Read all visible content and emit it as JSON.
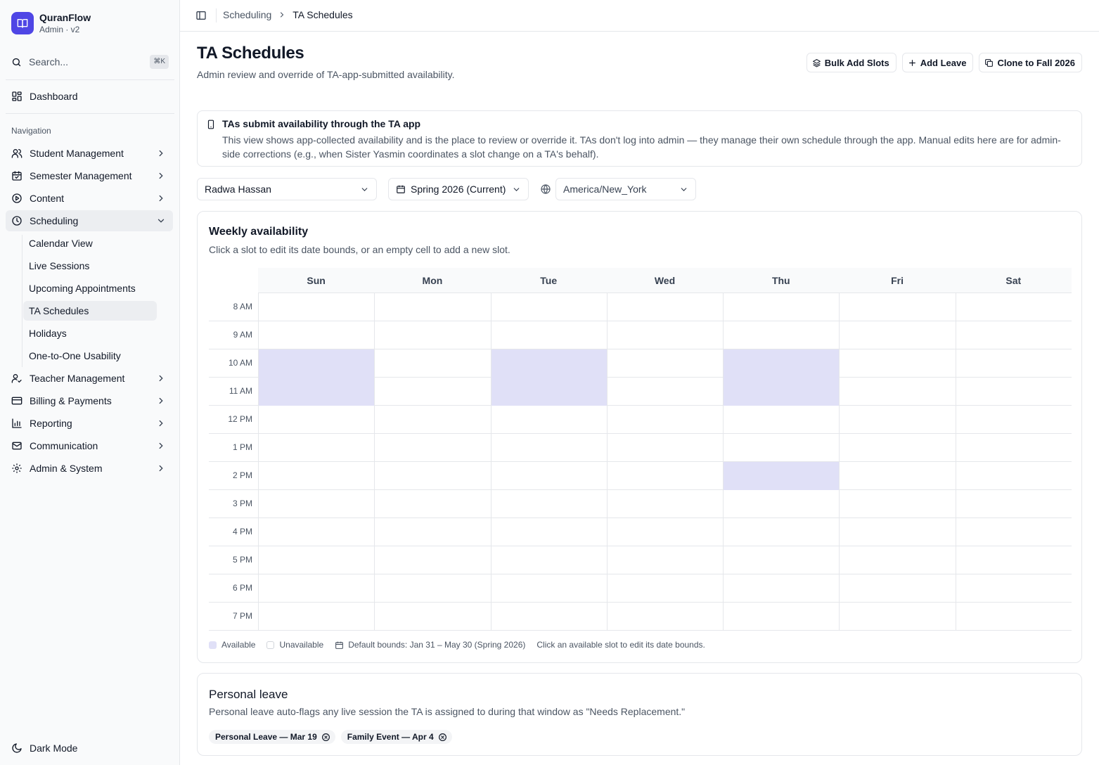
{
  "app": {
    "name": "QuranFlow",
    "subtitle": "Admin · v2"
  },
  "search": {
    "placeholder": "Search...",
    "shortcut": "⌘K"
  },
  "sidebar": {
    "dashboard_label": "Dashboard",
    "section_label": "Navigation",
    "items": [
      {
        "label": "Student Management",
        "icon": "users-icon"
      },
      {
        "label": "Semester Management",
        "icon": "calendar-check-icon"
      },
      {
        "label": "Content",
        "icon": "play-circle-icon"
      },
      {
        "label": "Scheduling",
        "icon": "clock-icon",
        "expanded": true
      },
      {
        "label": "Teacher Management",
        "icon": "user-check-icon"
      },
      {
        "label": "Billing & Payments",
        "icon": "credit-card-icon"
      },
      {
        "label": "Reporting",
        "icon": "bar-chart-icon"
      },
      {
        "label": "Communication",
        "icon": "mail-icon"
      },
      {
        "label": "Admin & System",
        "icon": "gear-icon"
      }
    ],
    "scheduling_children": [
      {
        "label": "Calendar View"
      },
      {
        "label": "Live Sessions"
      },
      {
        "label": "Upcoming Appointments"
      },
      {
        "label": "TA Schedules",
        "active": true
      },
      {
        "label": "Holidays"
      },
      {
        "label": "One-to-One Usability"
      }
    ],
    "dark_mode_label": "Dark Mode"
  },
  "breadcrumb": {
    "parent": "Scheduling",
    "current": "TA Schedules"
  },
  "page": {
    "title": "TA Schedules",
    "description": "Admin review and override of TA-app-submitted availability."
  },
  "actions": {
    "bulk_add": "Bulk Add Slots",
    "add_leave": "Add Leave",
    "clone": "Clone to Fall 2026"
  },
  "info": {
    "title": "TAs submit availability through the TA app",
    "body": "This view shows app-collected availability and is the place to review or override it. TAs don't log into admin — they manage their own schedule through the app. Manual edits here are for admin-side corrections (e.g., when Sister Yasmin coordinates a slot change on a TA's behalf)."
  },
  "filters": {
    "ta": "Radwa Hassan",
    "semester": "Spring 2026 (Current)",
    "timezone": "America/New_York"
  },
  "weekly": {
    "title": "Weekly availability",
    "description": "Click a slot to edit its date bounds, or an empty cell to add a new slot.",
    "days": [
      "Sun",
      "Mon",
      "Tue",
      "Wed",
      "Thu",
      "Fri",
      "Sat"
    ],
    "hours": [
      "8 AM",
      "9 AM",
      "10 AM",
      "11 AM",
      "12 PM",
      "1 PM",
      "2 PM",
      "3 PM",
      "4 PM",
      "5 PM",
      "6 PM",
      "7 PM"
    ],
    "available_slots": [
      {
        "day": "Sun",
        "hour": "10 AM"
      },
      {
        "day": "Sun",
        "hour": "11 AM"
      },
      {
        "day": "Tue",
        "hour": "10 AM"
      },
      {
        "day": "Tue",
        "hour": "11 AM"
      },
      {
        "day": "Thu",
        "hour": "10 AM"
      },
      {
        "day": "Thu",
        "hour": "11 AM"
      },
      {
        "day": "Thu",
        "hour": "2 PM"
      }
    ],
    "available_color": "#e0e0f7",
    "legend": {
      "available": "Available",
      "unavailable": "Unavailable",
      "bounds": "Default bounds: Jan 31 – May 30 (Spring 2026)",
      "hint": "Click an available slot to edit its date bounds."
    }
  },
  "leave": {
    "title": "Personal leave",
    "description": "Personal leave auto-flags any live session the TA is assigned to during that window as \"Needs Replacement.\"",
    "chips": [
      {
        "label": "Personal Leave — Mar 19"
      },
      {
        "label": "Family Event — Apr 4"
      }
    ]
  },
  "colors": {
    "brand": "#4f46e5",
    "available_slot": "#e0e0f7"
  }
}
